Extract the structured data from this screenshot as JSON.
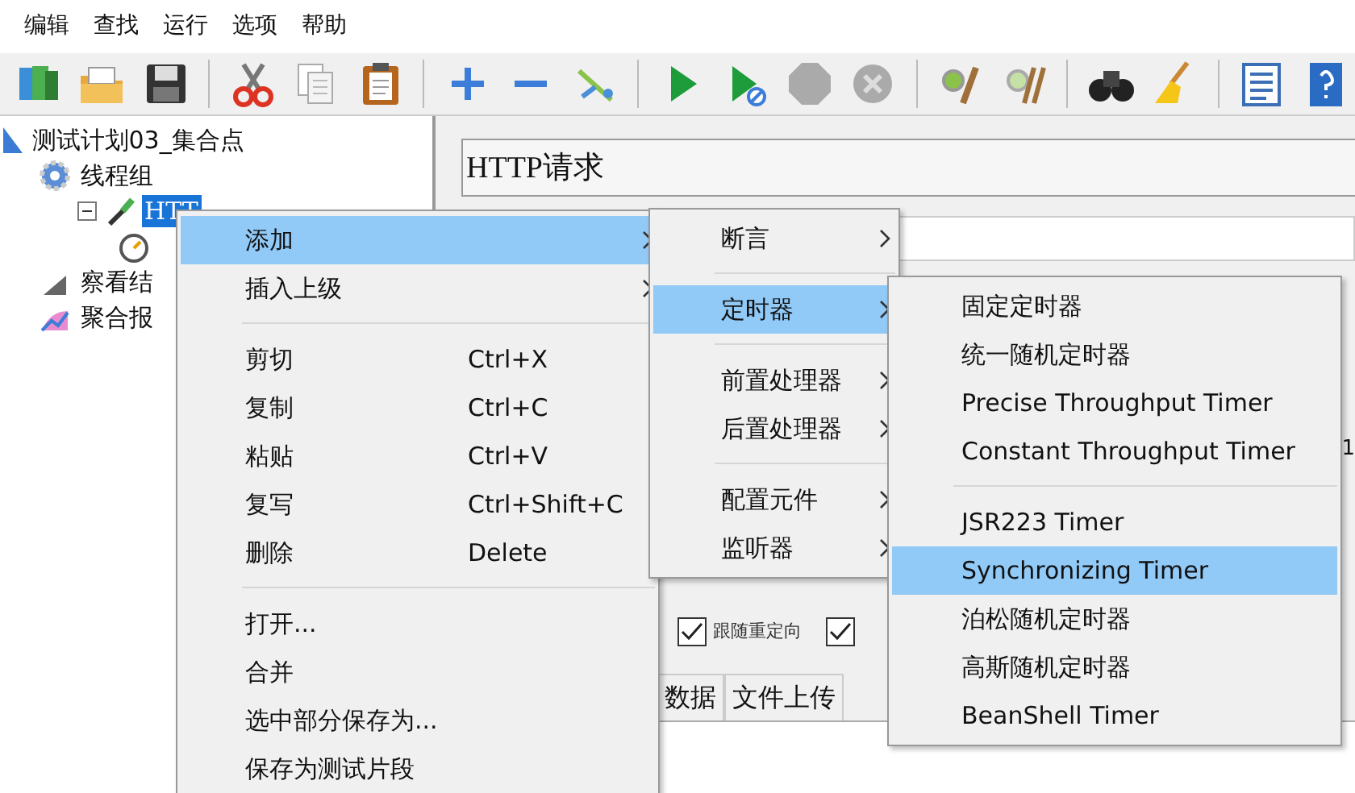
{
  "menubar": [
    {
      "label": "编辑"
    },
    {
      "label": "查找"
    },
    {
      "label": "运行"
    },
    {
      "label": "选项"
    },
    {
      "label": "帮助"
    }
  ],
  "tree": [
    {
      "label": "测试计划03_集合点",
      "kind": "plan",
      "selected": false,
      "children": [
        {
          "label": "线程组",
          "kind": "thread_group",
          "selected": false,
          "children": [
            {
              "label": "HTT",
              "kind": "sampler",
              "selected": true,
              "expanded": true,
              "children": [
                {
                  "kind": "timer"
                }
              ]
            }
          ]
        },
        {
          "label": "察看结",
          "kind": "results",
          "selected": false
        },
        {
          "label": "聚合报",
          "kind": "report",
          "selected": false
        }
      ]
    }
  ],
  "panel": {
    "title": "HTTP请求",
    "checkboxes": [
      {
        "label": "跟随重定向",
        "checked": true
      },
      {
        "checked": true
      }
    ],
    "tabs": [
      {
        "label": "数据"
      },
      {
        "label": "文件上传"
      }
    ],
    "edge_text": "1"
  },
  "context_menu": [
    {
      "kind": "item",
      "label": "添加",
      "submenu": true,
      "selected": true
    },
    {
      "kind": "item",
      "label": "插入上级",
      "submenu": true,
      "selected": false
    },
    {
      "kind": "separator"
    },
    {
      "kind": "item",
      "label": "剪切",
      "shortcut": "Ctrl+X",
      "selected": false
    },
    {
      "kind": "item",
      "label": "复制",
      "shortcut": "Ctrl+C",
      "selected": false
    },
    {
      "kind": "item",
      "label": "粘贴",
      "shortcut": "Ctrl+V",
      "selected": false
    },
    {
      "kind": "item",
      "label": "复写",
      "shortcut": "Ctrl+Shift+C",
      "selected": false
    },
    {
      "kind": "item",
      "label": "删除",
      "shortcut": "Delete",
      "selected": false
    },
    {
      "kind": "separator"
    },
    {
      "kind": "item",
      "label": "打开...",
      "selected": false
    },
    {
      "kind": "item",
      "label": "合并",
      "selected": false
    },
    {
      "kind": "item",
      "label": "选中部分保存为...",
      "selected": false
    },
    {
      "kind": "item",
      "label": "保存为测试片段",
      "selected": false
    }
  ],
  "add_submenu": [
    {
      "kind": "item",
      "label": "断言",
      "submenu": true,
      "selected": false
    },
    {
      "kind": "separator"
    },
    {
      "kind": "item",
      "label": "定时器",
      "submenu": true,
      "selected": true
    },
    {
      "kind": "separator"
    },
    {
      "kind": "item",
      "label": "前置处理器",
      "submenu": true,
      "selected": false
    },
    {
      "kind": "item",
      "label": "后置处理器",
      "submenu": true,
      "selected": false
    },
    {
      "kind": "separator"
    },
    {
      "kind": "item",
      "label": "配置元件",
      "submenu": true,
      "selected": false
    },
    {
      "kind": "item",
      "label": "监听器",
      "submenu": true,
      "selected": false
    }
  ],
  "timer_submenu": [
    {
      "kind": "item",
      "label": "固定定时器",
      "selected": false
    },
    {
      "kind": "item",
      "label": "统一随机定时器",
      "selected": false
    },
    {
      "kind": "item",
      "label": "Precise Throughput Timer",
      "selected": false
    },
    {
      "kind": "item",
      "label": "Constant Throughput Timer",
      "selected": false
    },
    {
      "kind": "separator"
    },
    {
      "kind": "item",
      "label": "JSR223 Timer",
      "selected": false
    },
    {
      "kind": "item",
      "label": "Synchronizing Timer",
      "selected": true
    },
    {
      "kind": "item",
      "label": "泊松随机定时器",
      "selected": false
    },
    {
      "kind": "item",
      "label": "高斯随机定时器",
      "selected": false
    },
    {
      "kind": "item",
      "label": "BeanShell Timer",
      "selected": false
    }
  ]
}
